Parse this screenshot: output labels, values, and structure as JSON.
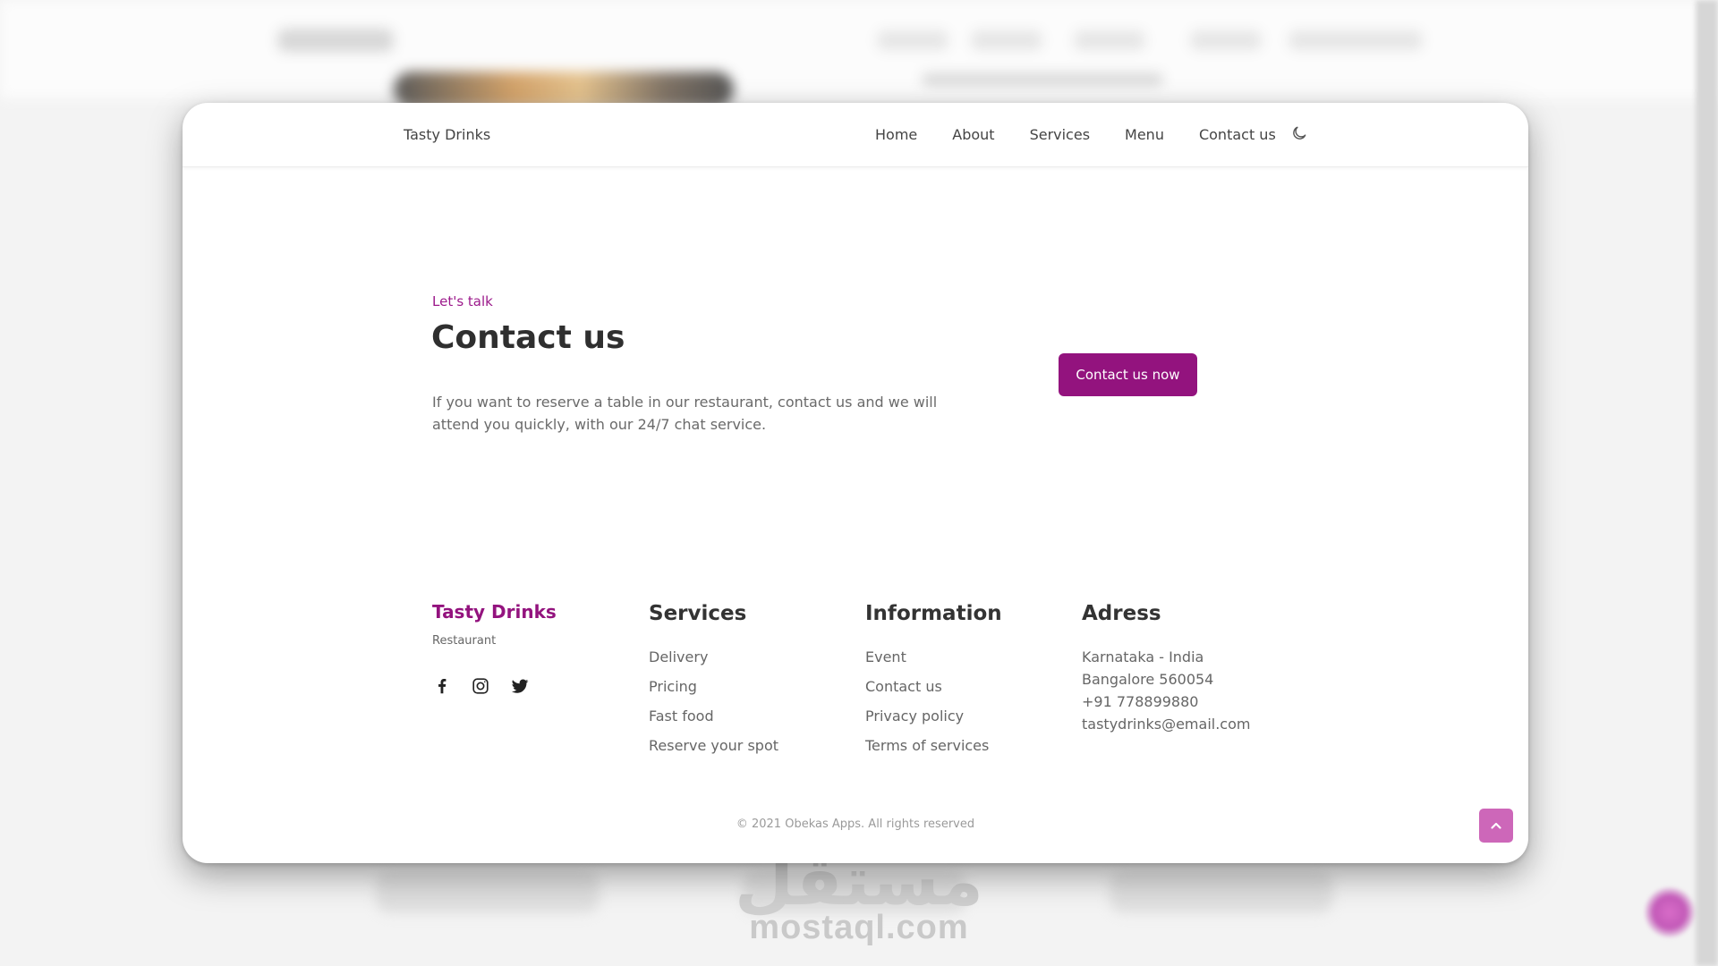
{
  "background": {
    "watermark_arabic": "مستقل",
    "watermark_domain": "mostaql.com"
  },
  "navbar": {
    "brand": "Tasty Drinks",
    "links": [
      "Home",
      "About",
      "Services",
      "Menu",
      "Contact us"
    ],
    "theme_toggle_icon": "moon-icon"
  },
  "contact_section": {
    "eyebrow": "Let's talk",
    "title": "Contact us",
    "description": "If you want to reserve a table in our restaurant, contact us and we will attend you quickly, with our 24/7 chat service.",
    "cta_label": "Contact us now"
  },
  "footer": {
    "brand": "Tasty Drinks",
    "subtitle": "Restaurant",
    "social_icons": [
      "facebook-icon",
      "instagram-icon",
      "twitter-icon"
    ],
    "services": {
      "heading": "Services",
      "items": [
        "Delivery",
        "Pricing",
        "Fast food",
        "Reserve your spot"
      ]
    },
    "information": {
      "heading": "Information",
      "items": [
        "Event",
        "Contact us",
        "Privacy policy",
        "Terms of services"
      ]
    },
    "address": {
      "heading": "Adress",
      "lines": [
        "Karnataka - India",
        "Bangalore 560054",
        "+91 778899880",
        "tastydrinks@email.com"
      ]
    },
    "copyright": "© 2021 Obekas Apps. All rights reserved"
  },
  "colors": {
    "accent": "#93137e",
    "eyebrow": "#9c1a8b",
    "scroll_top_button": "#cd67b9",
    "heading_text": "#2f2f2f",
    "body_text": "#666666"
  }
}
